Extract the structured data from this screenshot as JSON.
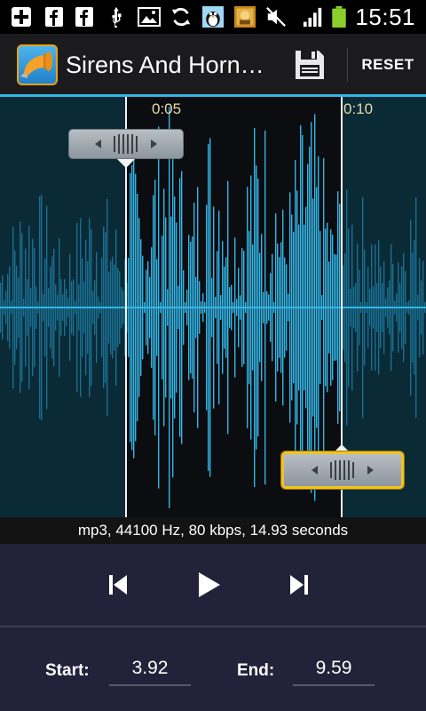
{
  "status_bar": {
    "time": "15:51",
    "icons": [
      "plus-box-icon",
      "facebook-icon",
      "facebook-icon",
      "usb-icon",
      "image-icon",
      "sync-icon",
      "penguin-app-icon",
      "game-app-icon",
      "mute-icon",
      "signal-icon",
      "battery-icon"
    ]
  },
  "action_bar": {
    "title": "Sirens And Horn…",
    "save_icon": "floppy-disk-icon",
    "reset_label": "RESET"
  },
  "waveform": {
    "timecodes": [
      "0:05",
      "0:10"
    ],
    "start_seconds": 3.92,
    "end_seconds": 9.59
  },
  "info": {
    "text": "mp3, 44100 Hz, 80 kbps, 14.93 seconds"
  },
  "transport": {
    "prev_icon": "skip-previous-icon",
    "play_icon": "play-icon",
    "next_icon": "skip-next-icon"
  },
  "controls": {
    "start_label": "Start:",
    "start_value": "3.92",
    "end_label": "End:",
    "end_value": "9.59"
  },
  "colors": {
    "accent": "#33b5e5",
    "wave_unselected": "#1a6e91",
    "wave_selected": "#33b5e5",
    "focus_handle": "#f0c321"
  }
}
